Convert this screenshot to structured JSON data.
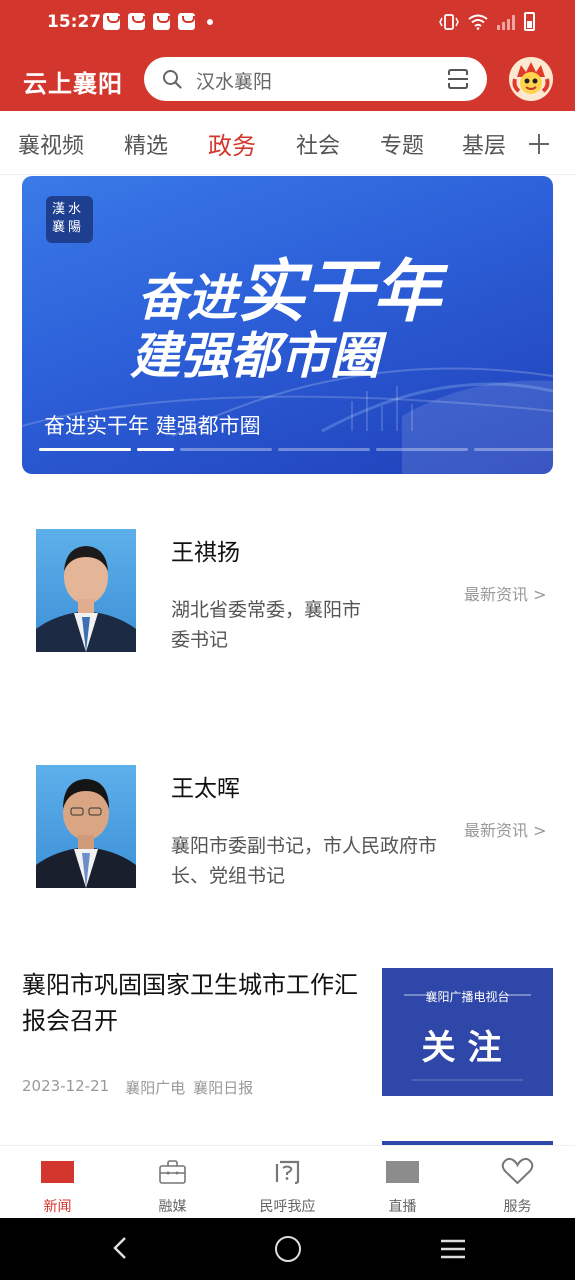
{
  "status_bar": {
    "time": "15:27"
  },
  "header": {
    "app_title": "云上襄阳",
    "search_placeholder": "汉水襄阳"
  },
  "tabs": [
    {
      "label": "襄视频",
      "active": false
    },
    {
      "label": "精选",
      "active": false
    },
    {
      "label": "政务",
      "active": true
    },
    {
      "label": "社会",
      "active": false
    },
    {
      "label": "专题",
      "active": false
    },
    {
      "label": "基层",
      "active": false
    }
  ],
  "banner": {
    "logo_text": "漢水襄陽",
    "headline_part1": "奋进",
    "headline_part2": "实干年",
    "headline_line2": "建强都市圈",
    "caption": "奋进实干年 建强都市圈",
    "slide_count": 6,
    "active_slide": 1
  },
  "leaders": [
    {
      "name": "王祺扬",
      "title": "湖北省委常委，襄阳市委书记",
      "link": "最新资讯 >"
    },
    {
      "name": "王太晖",
      "title": "襄阳市委副书记，市人民政府市长、党组书记",
      "link": "最新资讯 >"
    }
  ],
  "news": [
    {
      "title": "襄阳市巩固国家卫生城市工作汇报会召开",
      "date": "2023-12-21",
      "sources": [
        "襄阳广电",
        "襄阳日报"
      ],
      "thumb_top": "襄阳广播电视台",
      "thumb_big": "关注"
    }
  ],
  "bottom_nav": [
    {
      "label": "新闻",
      "icon": "news-icon",
      "active": true
    },
    {
      "label": "融媒",
      "icon": "briefcase-icon",
      "active": false
    },
    {
      "label": "民呼我应",
      "icon": "question-mark-icon",
      "active": false
    },
    {
      "label": "直播",
      "icon": "live-icon",
      "active": false
    },
    {
      "label": "服务",
      "icon": "heart-icon",
      "active": false
    }
  ],
  "colors": {
    "brand_red": "#d2362d",
    "banner_blue": "#2c5fd8"
  }
}
